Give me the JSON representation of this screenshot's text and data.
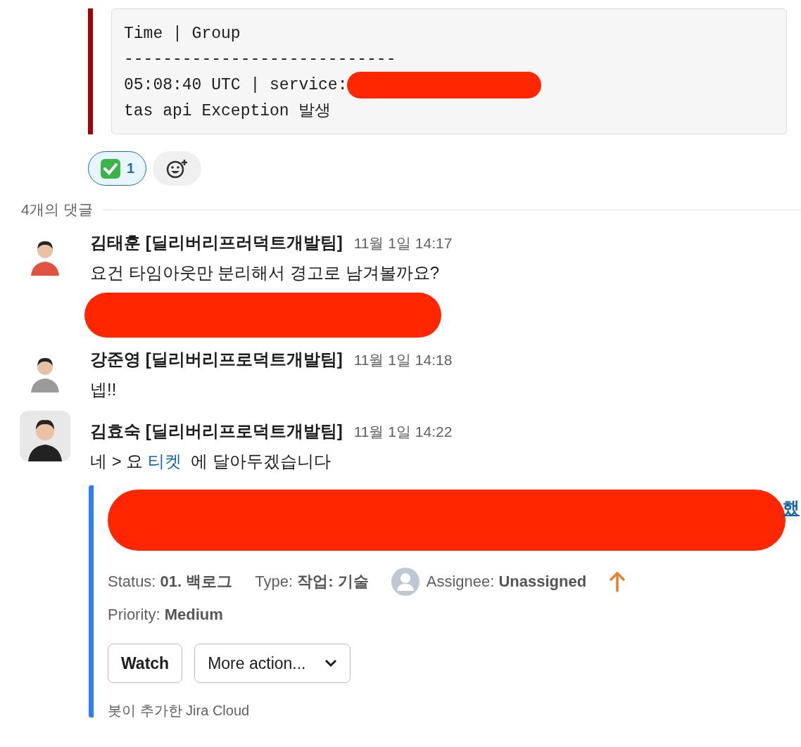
{
  "previous_attachment": {
    "code_lines": [
      {
        "text": "Time | Group",
        "redacted": false
      },
      {
        "text": "----------------------------",
        "redacted": false
      },
      {
        "text": "05:08:40 UTC | service:",
        "redacted": true
      },
      {
        "text": "tas api Exception 발생",
        "redacted": false
      }
    ]
  },
  "reactions": [
    {
      "kind": "check",
      "count": "1",
      "selected": true
    }
  ],
  "thread_header": "4개의 댓글",
  "messages": [
    {
      "author": "김태훈 [딜리버리프러덕트개발팀]",
      "time": "11월 1일 14:17",
      "parts": [
        {
          "kind": "text",
          "text": "요건 타임아웃만 분리해서 경고로 남겨볼까요?"
        }
      ],
      "redacted_below": true
    },
    {
      "author": "강준영 [딜리버리프로덕트개발팀]",
      "time": "11월 1일 14:18",
      "parts": [
        {
          "kind": "text",
          "text": "넵!!"
        }
      ],
      "redacted_below": false
    },
    {
      "author": "김효숙 [딜리버리프로덕트개발팀]",
      "time": "11월 1일 14:22",
      "parts": [
        {
          "kind": "text",
          "text": "네 > 요 "
        },
        {
          "kind": "link",
          "text": "티켓"
        },
        {
          "kind": "text",
          "text": "  에 달아두겠습니다"
        }
      ],
      "redacted_below": false
    }
  ],
  "jira_card": {
    "title_redacted": true,
    "title_tail": "했",
    "fields_row_1": [
      {
        "kind": "text",
        "label": "Status:",
        "value": "01. 백로그"
      },
      {
        "kind": "text",
        "label": "Type:",
        "value": "작업: 기술"
      },
      {
        "kind": "assignee",
        "label": "Assignee:",
        "value": "Unassigned"
      },
      {
        "kind": "priority_arrow"
      }
    ],
    "fields_row_2": [
      {
        "kind": "text",
        "label": "Priority:",
        "value": "Medium"
      }
    ],
    "buttons": [
      {
        "kind": "button",
        "label": "Watch"
      },
      {
        "kind": "dropdown",
        "label": "More action..."
      }
    ],
    "footer": "봇이 추가한 Jira Cloud"
  }
}
